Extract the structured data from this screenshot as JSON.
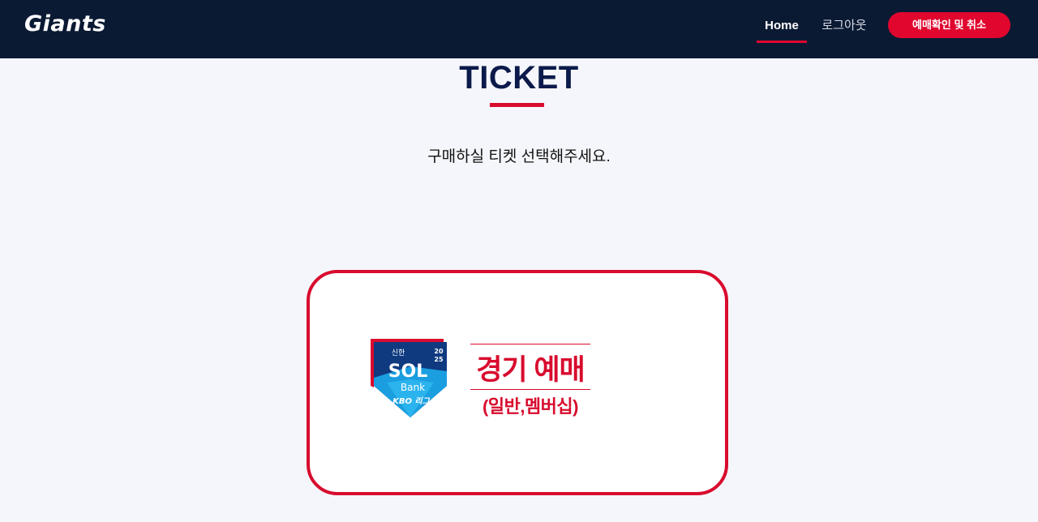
{
  "header": {
    "logo_text": "Giants",
    "nav": {
      "home_label": "Home",
      "logout_label": "로그아웃"
    },
    "reserve_button_label": "예매확인 및 취소"
  },
  "main": {
    "title": "TICKET",
    "subtitle": "구매하실 티켓 선택해주세요."
  },
  "ticket_card": {
    "badge": {
      "top_text": "신한",
      "year_line1": "20",
      "year_line2": "25",
      "brand": "SOL",
      "bank": "Bank",
      "league": "KBO 리그"
    },
    "title": "경기 예매",
    "subtitle": "(일반,멤버십)"
  },
  "colors": {
    "header_bg": "#0b1a33",
    "accent": "#d80c2e",
    "button": "#e0062e",
    "title_text": "#0b1a4a",
    "page_bg": "#f5f6fb"
  }
}
